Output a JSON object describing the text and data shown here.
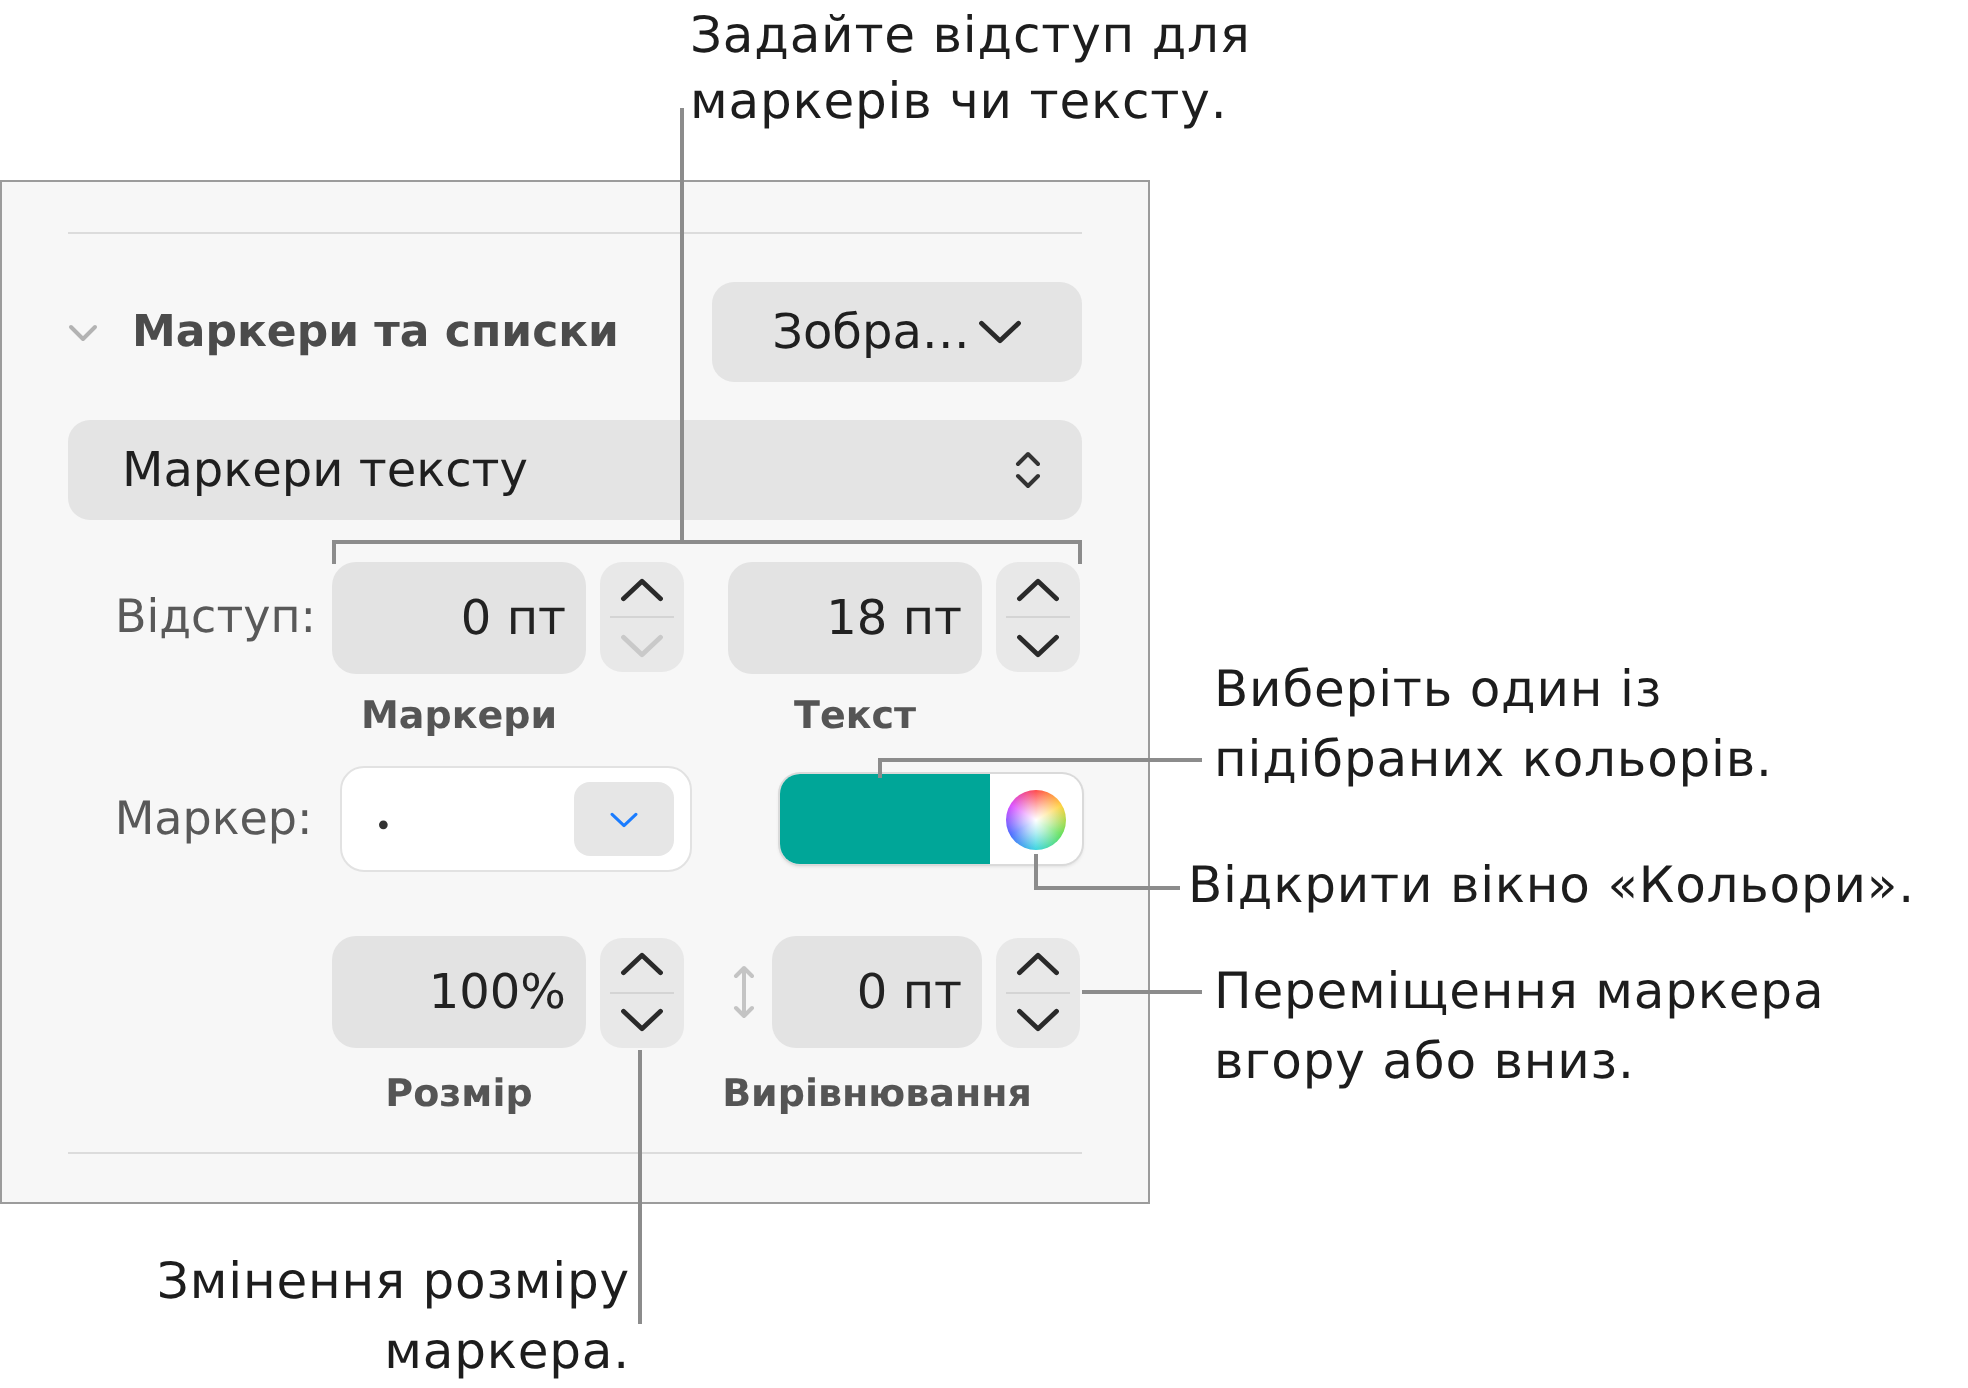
{
  "panel": {
    "section": {
      "title": "Маркери та списки",
      "expanded": true,
      "style_button": "Зобра…"
    },
    "bullet_style": "Маркери тексту",
    "indent": {
      "label": "Відступ:",
      "fields": [
        {
          "value": "0 пт",
          "caption": "Маркери",
          "decrement_disabled": true
        },
        {
          "value": "18 пт",
          "caption": "Текст",
          "decrement_disabled": false
        }
      ]
    },
    "marker": {
      "label": "Маркер:",
      "bullet": "•",
      "color": "#00a698"
    },
    "size": {
      "value": "100%",
      "caption": "Розмір",
      "decrement_disabled": false
    },
    "alignment": {
      "value": "0 пт",
      "caption": "Вирівнювання",
      "decrement_disabled": false
    }
  },
  "callouts": [
    {
      "lines": [
        "Задайте відступ для",
        "маркерів чи тексту."
      ]
    },
    {
      "lines": [
        "Виберіть один із",
        "підібраних кольорів."
      ]
    },
    {
      "lines": [
        "Відкрити вікно «Кольори»."
      ]
    },
    {
      "lines": [
        "Переміщення маркера",
        "вгору або вниз."
      ]
    },
    {
      "lines": [
        "Змінення розміру",
        "маркера."
      ]
    }
  ]
}
